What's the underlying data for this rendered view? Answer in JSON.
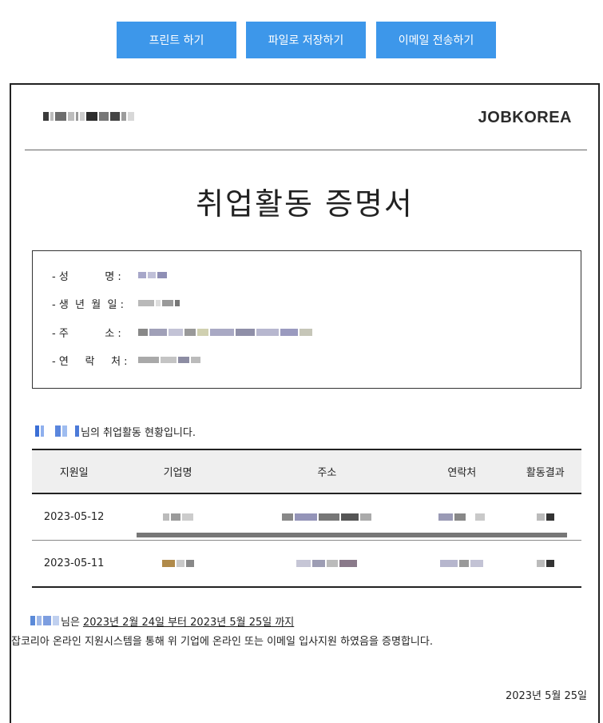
{
  "toolbar": {
    "print_label": "프린트 하기",
    "save_label": "파일로 저장하기",
    "email_label": "이메일 전송하기"
  },
  "header": {
    "logo": "JOBKOREA"
  },
  "title": "취업활동 증명서",
  "info": {
    "name_label": "- 성           명 :",
    "birth_label": "- 생  년  월  일 :",
    "address_label": "- 주           소 :",
    "contact_label": "- 연     락     처 :"
  },
  "summary_suffix": "님의 취업활동 현황입니다.",
  "history": {
    "headers": [
      "지원일",
      "기업명",
      "주소",
      "연락처",
      "활동결과"
    ],
    "rows": [
      {
        "date": "2023-05-12"
      },
      {
        "date": "2023-05-11"
      }
    ]
  },
  "certification": {
    "prefix": "님은",
    "period": "2023년 2월 24일 부터 2023년 5월 25일 까지",
    "statement": "잡코리아 온라인 지원시스템을 통해 위 기업에 온라인 또는 이메일 입사지원 하였음을 증명합니다."
  },
  "issue_date": "2023년 5월 25일"
}
